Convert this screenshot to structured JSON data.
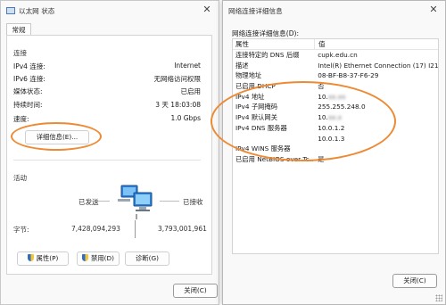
{
  "left_window": {
    "title": "以太网 状态",
    "tab": "常规",
    "connection": {
      "group_label": "连接",
      "rows": [
        {
          "key": "IPv4 连接:",
          "value": "Internet"
        },
        {
          "key": "IPv6 连接:",
          "value": "无网络访问权限"
        },
        {
          "key": "媒体状态:",
          "value": "已启用"
        },
        {
          "key": "持续时间:",
          "value": "3 天 18:03:08"
        },
        {
          "key": "速度:",
          "value": "1.0 Gbps"
        }
      ],
      "details_button": "详细信息(E)..."
    },
    "activity": {
      "group_label": "活动",
      "sent_label": "已发送",
      "received_label": "已接收",
      "bytes_label": "字节:",
      "bytes_sent": "7,428,094,293",
      "bytes_received": "3,793,001,961"
    },
    "buttons": {
      "properties": "属性(P)",
      "disable": "禁用(D)",
      "diagnose": "诊断(G)"
    },
    "close_button": "关闭(C)"
  },
  "right_window": {
    "title": "网络连接详细信息",
    "label": "网络连接详细信息(D):",
    "columns": {
      "property": "属性",
      "value": "值"
    },
    "rows": [
      {
        "property": "连接特定的 DNS 后缀",
        "value": "cupk.edu.cn"
      },
      {
        "property": "描述",
        "value": "Intel(R) Ethernet Connection (17) I219-V"
      },
      {
        "property": "物理地址",
        "value": "08-BF-B8-37-F6-29"
      },
      {
        "property": "已启用 DHCP",
        "value": "否"
      },
      {
        "property": "IPv4 地址",
        "value": "10."
      },
      {
        "property": "IPv4 子网掩码",
        "value": "255.255.248.0"
      },
      {
        "property": "IPv4 默认网关",
        "value": "10."
      },
      {
        "property": "IPv4 DNS 服务器",
        "value": "10.0.1.2"
      },
      {
        "property": "",
        "value": "10.0.1.3"
      },
      {
        "property": "IPv4 WINS 服务器",
        "value": ""
      },
      {
        "property": "已启用 NetBIOS over Tc...",
        "value": "是"
      }
    ],
    "close_button": "关闭(C)"
  },
  "colors": {
    "highlight_ellipse": "#ee8a33"
  }
}
